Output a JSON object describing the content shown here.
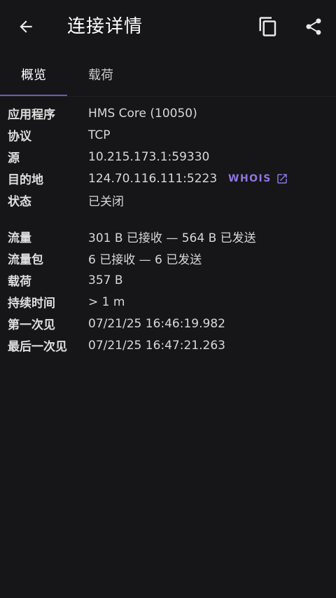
{
  "header": {
    "title": "连接详情"
  },
  "tabs": [
    {
      "label": "概览"
    },
    {
      "label": "载荷"
    }
  ],
  "overview": {
    "app_label": "应用程序",
    "app_value": "HMS Core (10050)",
    "protocol_label": "协议",
    "protocol_value": "TCP",
    "source_label": "源",
    "source_value": "10.215.173.1:59330",
    "destination_label": "目的地",
    "destination_value": "124.70.116.111:5223",
    "whois_label": "WHOIS",
    "status_label": "状态",
    "status_value": "已关闭",
    "traffic_label": "流量",
    "traffic_value": "301 B 已接收 — 564 B 已发送",
    "packets_label": "流量包",
    "packets_value": "6 已接收 — 6 已发送",
    "payload_label": "载荷",
    "payload_value": "357 B",
    "duration_label": "持续时间",
    "duration_value": "> 1 m",
    "first_seen_label": "第一次见",
    "first_seen_value": "07/21/25 16:46:19.982",
    "last_seen_label": "最后一次见",
    "last_seen_value": "07/21/25 16:47:21.263"
  },
  "colors": {
    "background": "#161517",
    "accent": "#6b56c4",
    "link": "#8c77e0"
  },
  "icons": {
    "back": "arrow-left-icon",
    "copy": "copy-icon",
    "share": "share-icon",
    "external": "external-link-icon"
  }
}
